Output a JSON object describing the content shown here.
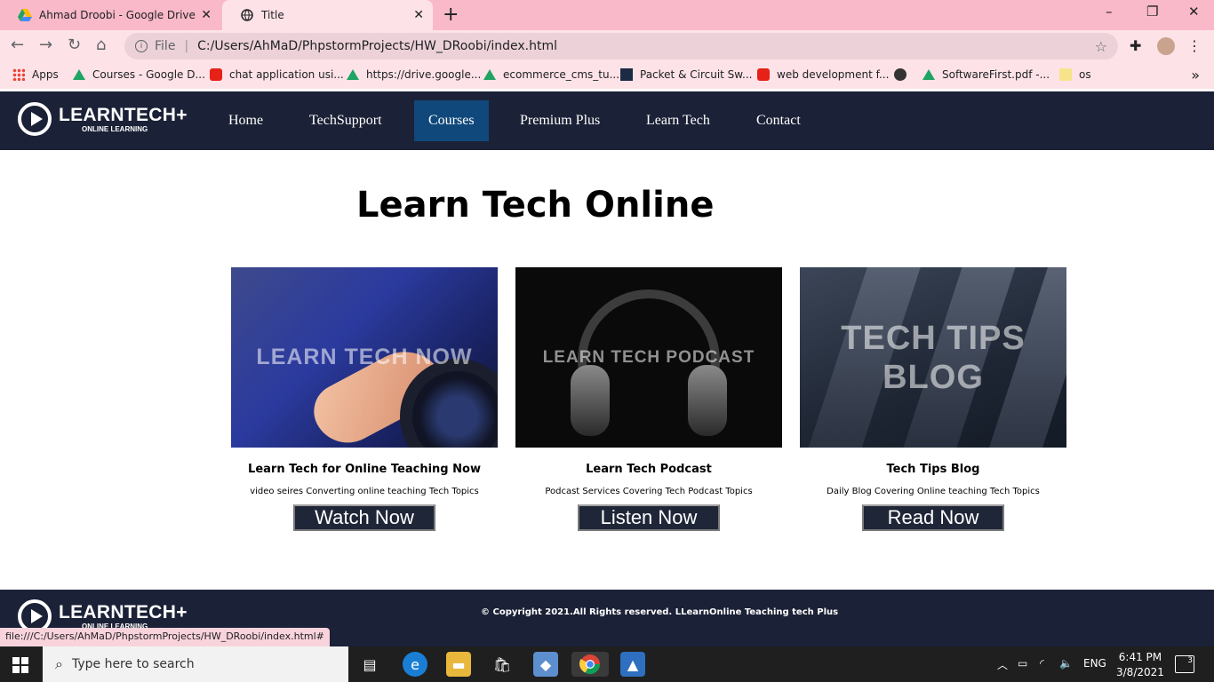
{
  "browser": {
    "tabs": [
      {
        "title": "Ahmad Droobi - Google Drive",
        "active": false
      },
      {
        "title": "Title",
        "active": true
      }
    ],
    "address": {
      "scheme_label": "File",
      "url": "C:/Users/AhMaD/PhpstormProjects/HW_DRoobi/index.html"
    },
    "bookmarks": [
      {
        "label": "Apps",
        "icon": "apps-grid-icon"
      },
      {
        "label": "Courses - Google D...",
        "icon": "google-drive-icon"
      },
      {
        "label": "chat application usi...",
        "icon": "youtube-icon"
      },
      {
        "label": "https://drive.google...",
        "icon": "google-drive-icon"
      },
      {
        "label": "ecommerce_cms_tu...",
        "icon": "google-drive-icon"
      },
      {
        "label": "Packet & Circuit Sw...",
        "icon": "sf-icon"
      },
      {
        "label": "web development f...",
        "icon": "youtube-icon"
      },
      {
        "label": "",
        "icon": "globe-icon"
      },
      {
        "label": "SoftwareFirst.pdf -...",
        "icon": "google-drive-icon"
      },
      {
        "label": "os",
        "icon": "folder-icon"
      }
    ],
    "status_url": "file:///C:/Users/AhMaD/PhpstormProjects/HW_DRoobi/index.html#"
  },
  "site": {
    "logo_name": "LEARNTECH+",
    "logo_sub": "ONLINE LEARNING",
    "nav": [
      "Home",
      "TechSupport",
      "Courses",
      "Premium Plus",
      "Learn Tech",
      "Contact"
    ],
    "nav_active": "Courses",
    "heading": "Learn Tech Online",
    "cards": [
      {
        "image_text": "LEARN TECH NOW",
        "title": "Learn Tech for Online Teaching Now",
        "desc": "video seires Converting online teaching Tech Topics",
        "button": "Watch Now"
      },
      {
        "image_text": "LEARN TECH PODCAST",
        "title": "Learn Tech Podcast",
        "desc": "Podcast Services Covering Tech Podcast Topics",
        "button": "Listen Now"
      },
      {
        "image_text_1": "TECH TIPS",
        "image_text_2": "BLOG",
        "title": "Tech Tips Blog",
        "desc": "Daily Blog Covering Online teaching Tech Topics",
        "button": "Read Now"
      }
    ],
    "footer_copyright": "© Copyright 2021.All Rights reserved. LLearnOnline Teaching tech Plus"
  },
  "taskbar": {
    "search_placeholder": "Type here to search",
    "lang": "ENG",
    "time": "6:41 PM",
    "date": "3/8/2021",
    "notifications": "3"
  },
  "colors": {
    "nav_bg": "#1b2136",
    "nav_active": "#10487b",
    "tabstrip": "#f9b9c8",
    "button_bg": "#1f2638"
  }
}
